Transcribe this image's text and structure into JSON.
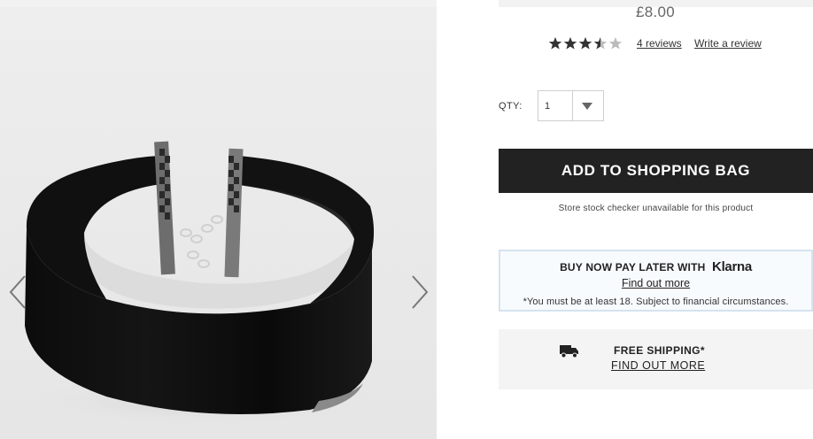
{
  "product": {
    "price": "£8.00",
    "rating": 3.5,
    "rating_max": 5,
    "reviews_label": "4 reviews",
    "write_review_label": "Write a review"
  },
  "quantity": {
    "label": "QTY:",
    "value": "1"
  },
  "actions": {
    "add_to_bag_label": "ADD TO SHOPPING BAG",
    "stock_note": "Store stock checker unavailable for this product"
  },
  "klarna": {
    "heading": "BUY NOW PAY LATER WITH",
    "logo_text": "Klarna",
    "link_label": "Find out more",
    "note": "*You must be at least 18. Subject to financial circumstances."
  },
  "shipping": {
    "title": "FREE SHIPPING*",
    "link_label": "FIND OUT MORE"
  },
  "icons": {
    "gallery_prev": "chevron-left-icon",
    "gallery_next": "chevron-right-icon",
    "qty_dropdown": "chevron-down-icon",
    "shipping": "truck-icon",
    "rating": "star-icon"
  },
  "colors": {
    "button_bg": "#222222",
    "klarna_border": "#d5e3ef",
    "shipping_bg": "#f4f4f4",
    "star_filled": "#333333",
    "star_empty": "#bbbbbb"
  }
}
